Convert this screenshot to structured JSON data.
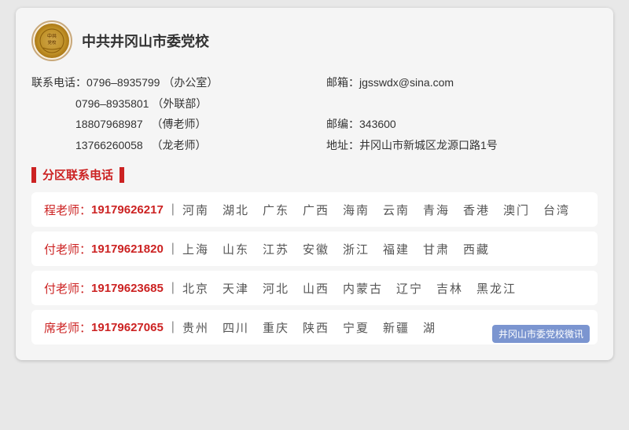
{
  "header": {
    "org_name": "中共井冈山市委党校",
    "logo_text": "党校"
  },
  "contact": {
    "phone_label": "联系电话：",
    "phones": [
      {
        "number": "0796–8935799",
        "note": "（办公室）"
      },
      {
        "number": "0796–8935801",
        "note": "（外联部）"
      },
      {
        "number": "18807968987",
        "note": "  （傅老师）"
      },
      {
        "number": "13766260058",
        "note": "  （龙老师）"
      }
    ],
    "email_label": "邮箱：",
    "email": "jgsswdx@sina.com",
    "postcode_label": "邮编：",
    "postcode": "343600",
    "address_label": "地址：",
    "address": "井冈山市新城区龙源口路1号"
  },
  "section_title": "分区联系电话",
  "regions": [
    {
      "teacher": "程老师：",
      "phone": "19179626217",
      "areas": "河南  湖北  广东  广西  海南  云南  青海  香港  澳门  台湾"
    },
    {
      "teacher": "付老师：",
      "phone": "19179621820",
      "areas": "上海  山东  江苏  安徽  浙江  福建  甘肃  西藏"
    },
    {
      "teacher": "付老师：",
      "phone": "19179623685",
      "areas": "北京  天津  河北  山西  内蒙古  辽宁  吉林  黑龙江"
    },
    {
      "teacher": "席老师：",
      "phone": "19179627065",
      "areas": "贵州  四川  重庆  陕西  宁夏  新疆  湖...",
      "has_watermark": true,
      "watermark_text": "井冈山市委党校微讯"
    }
  ]
}
